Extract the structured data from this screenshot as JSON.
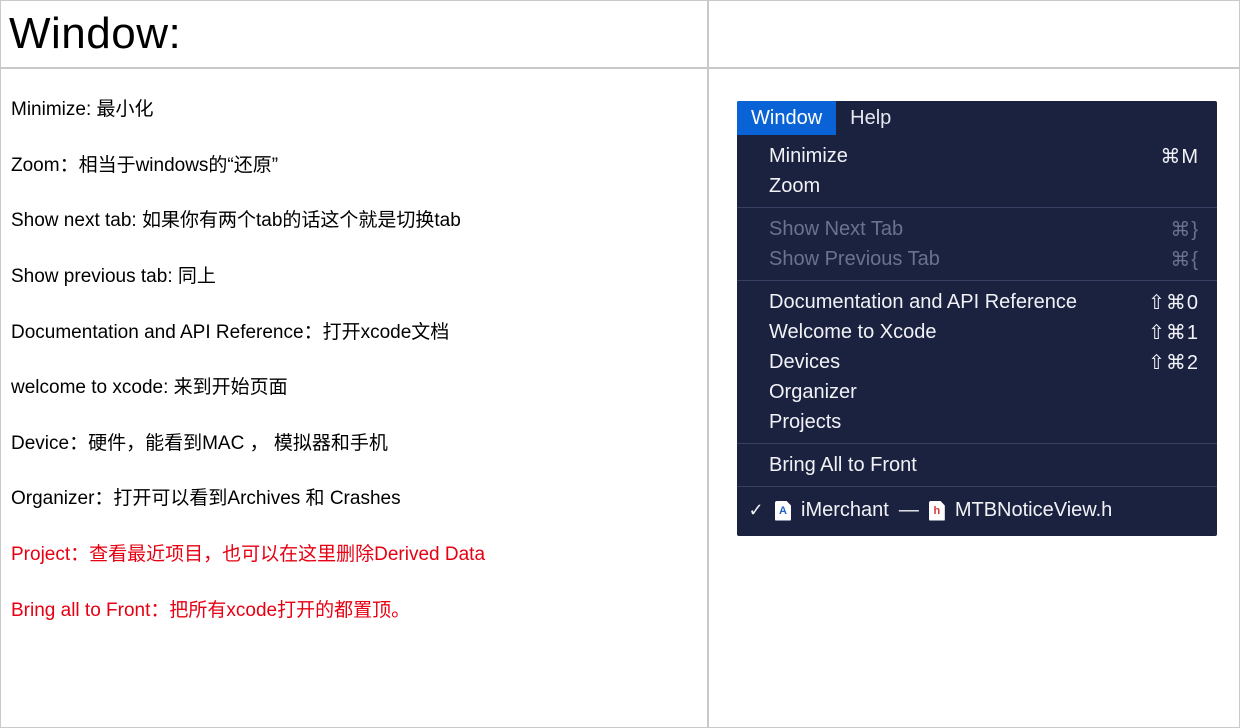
{
  "header": {
    "title": "Window:"
  },
  "notes": [
    {
      "text": "Minimize: 最小化",
      "red": false
    },
    {
      "text": "Zoom：相当于windows的“还原”",
      "red": false
    },
    {
      "text": "Show next tab: 如果你有两个tab的话这个就是切换tab",
      "red": false
    },
    {
      "text": "Show previous tab: 同上",
      "red": false
    },
    {
      "text": "Documentation and API Reference：打开xcode文档",
      "red": false
    },
    {
      "text": "welcome to xcode: 来到开始页面",
      "red": false
    },
    {
      "text": "Device：硬件，能看到MAC ， 模拟器和手机",
      "red": false
    },
    {
      "text": "Organizer：打开可以看到Archives 和 Crashes",
      "red": false
    },
    {
      "text": "Project：查看最近项目，也可以在这里删除Derived Data",
      "red": true
    },
    {
      "text": "Bring all to Front：把所有xcode打开的都置顶。",
      "red": true
    }
  ],
  "menu": {
    "bar": {
      "window": "Window",
      "help": "Help"
    },
    "groups": [
      [
        {
          "label": "Minimize",
          "shortcut": "⌘M",
          "disabled": false
        },
        {
          "label": "Zoom",
          "shortcut": "",
          "disabled": false
        }
      ],
      [
        {
          "label": "Show Next Tab",
          "shortcut": "⌘}",
          "disabled": true
        },
        {
          "label": "Show Previous Tab",
          "shortcut": "⌘{",
          "disabled": true
        }
      ],
      [
        {
          "label": "Documentation and API Reference",
          "shortcut": "⇧⌘0",
          "disabled": false
        },
        {
          "label": "Welcome to Xcode",
          "shortcut": "⇧⌘1",
          "disabled": false
        },
        {
          "label": "Devices",
          "shortcut": "⇧⌘2",
          "disabled": false
        },
        {
          "label": "Organizer",
          "shortcut": "",
          "disabled": false
        },
        {
          "label": "Projects",
          "shortcut": "",
          "disabled": false
        }
      ],
      [
        {
          "label": "Bring All to Front",
          "shortcut": "",
          "disabled": false
        }
      ]
    ],
    "open_windows": [
      {
        "checked": true,
        "project_icon_letter": "A",
        "project_name": "iMerchant",
        "separator": " — ",
        "file_icon_letter": "h",
        "file_name": "MTBNoticeView.h"
      }
    ]
  }
}
